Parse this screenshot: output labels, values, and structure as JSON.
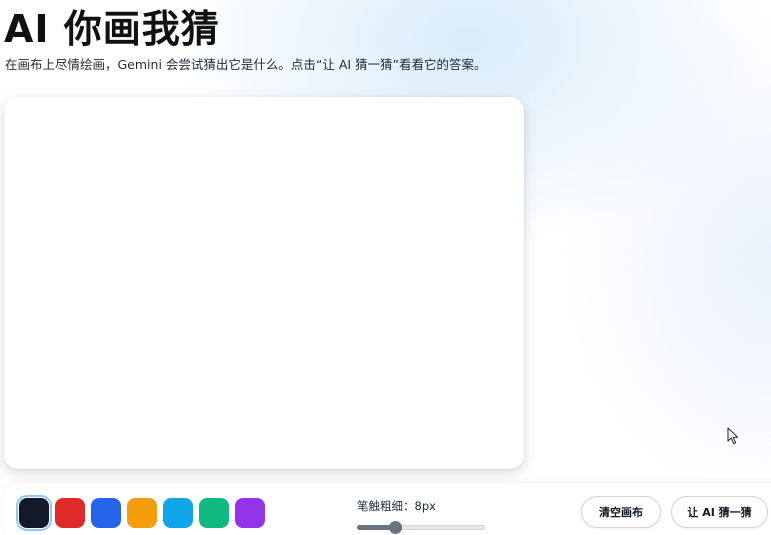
{
  "header": {
    "title": "AI 你画我猜",
    "subtitle": "在画布上尽情绘画，Gemini 会尝试猜出它是什么。点击“让 AI 猜一猜”看看它的答案。"
  },
  "palette": {
    "selected_index": 0,
    "colors": [
      {
        "name": "navy",
        "hex": "#111827"
      },
      {
        "name": "red",
        "hex": "#e02a2a"
      },
      {
        "name": "blue",
        "hex": "#2563eb"
      },
      {
        "name": "amber",
        "hex": "#f59e0b"
      },
      {
        "name": "sky",
        "hex": "#0ea5e9"
      },
      {
        "name": "emerald",
        "hex": "#10b981"
      },
      {
        "name": "violet",
        "hex": "#9333ea"
      }
    ]
  },
  "brush": {
    "label": "笔触粗细：8px",
    "fraction": 0.3
  },
  "actions": {
    "clear_label": "清空画布",
    "guess_label": "让 AI 猜一猜"
  }
}
